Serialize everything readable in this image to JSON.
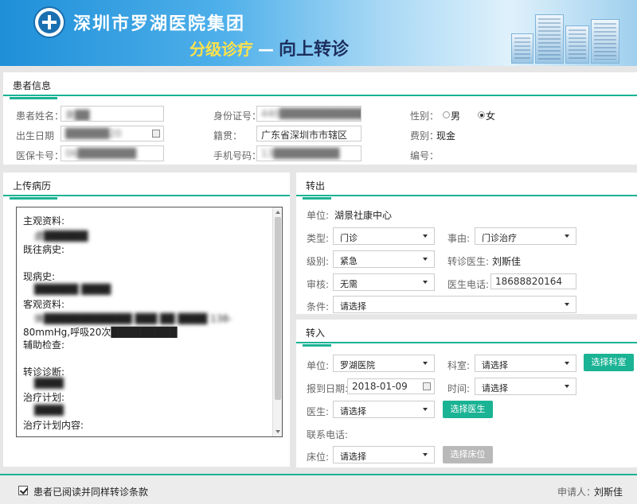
{
  "header": {
    "hospital_name": "深圳市罗湖医院集团",
    "subtitle_left": "分级诊疗",
    "subtitle_dash": "—",
    "subtitle_main": "向上转诊"
  },
  "patient": {
    "section_title": "患者信息",
    "name_label": "患者姓名：",
    "name_value": "黄██",
    "dob_label": "出生日期",
    "dob_value": "██████20",
    "insurance_label": "医保卡号：",
    "insurance_value": "06████████",
    "id_label": "身份证号：",
    "id_value": "440█████████████23",
    "native_label": "籍贯：",
    "native_value": "广东省深圳市市辖区",
    "phone_label": "手机号码：",
    "phone_value": "13█████████",
    "gender_label": "性别：",
    "gender_male": "男",
    "gender_female": "女",
    "fee_label": "费别：",
    "fee_value": "现金",
    "number_label": "编号："
  },
  "records": {
    "section_title": "上传病历",
    "lines": [
      "主观资料:",
      "虚██████",
      "既往病史:",
      "现病史:",
      "██████ ████",
      "客观资料:",
      "体████████████ ███ ██ ████ 138-",
      "80mmHg,呼吸20次█████████",
      "辅助检查:",
      "转诊诊断:",
      "████",
      "治疗计划:",
      "████",
      "治疗计划内容:"
    ]
  },
  "transfer_out": {
    "section_title": "转出",
    "unit_label": "单位:",
    "unit_value": "湖景社康中心",
    "type_label": "类型:",
    "type_value": "门诊",
    "reason_label": "事由:",
    "reason_value": "门诊治疗",
    "level_label": "级别:",
    "level_value": "紧急",
    "doctor_label": "转诊医生:",
    "doctor_value": "刘斯佳",
    "review_label": "审核:",
    "review_value": "无需",
    "doctor_phone_label": "医生电话:",
    "doctor_phone_value": "18688820164",
    "condition_label": "条件:",
    "condition_value": "请选择"
  },
  "transfer_in": {
    "section_title": "转入",
    "unit_label": "单位:",
    "unit_value": "罗湖医院",
    "dept_label": "科室:",
    "dept_value": "请选择",
    "select_dept_button": "选择科室",
    "date_label": "报到日期:",
    "date_value": "2018-01-09",
    "time_label": "时间:",
    "time_value": "请选择",
    "doctor_label": "医生:",
    "doctor_value": "请选择",
    "select_doctor_button": "选择医生",
    "contact_label": "联系电话:",
    "bed_label": "床位:",
    "bed_value": "请选择",
    "select_bed_button": "选择床位"
  },
  "footer": {
    "agree_text": "患者已阅读并同样转诊条款",
    "applicant_label": "申请人：",
    "applicant_value": "刘斯佳"
  },
  "colors": {
    "accent": "#1ab394",
    "banner": "#4fb0ea",
    "subtitle": "#ffe24a"
  }
}
